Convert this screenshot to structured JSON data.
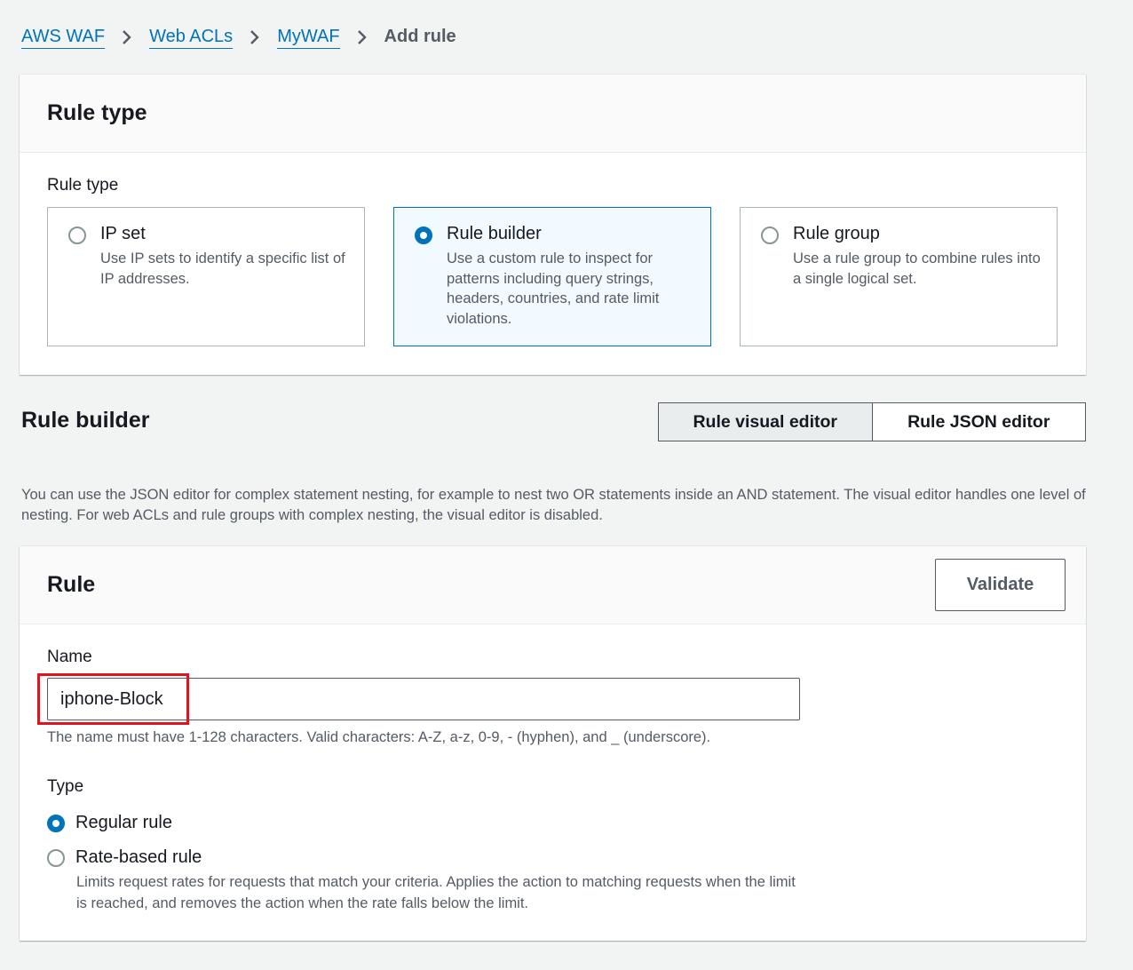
{
  "breadcrumb": {
    "items": [
      "AWS WAF",
      "Web ACLs",
      "MyWAF"
    ],
    "current": "Add rule"
  },
  "rule_type_panel": {
    "title": "Rule type",
    "field_label": "Rule type",
    "options": [
      {
        "title": "IP set",
        "description": "Use IP sets to identify a specific list of IP addresses.",
        "selected": false
      },
      {
        "title": "Rule builder",
        "description": "Use a custom rule to inspect for patterns including query strings, headers, countries, and rate limit violations.",
        "selected": true
      },
      {
        "title": "Rule group",
        "description": "Use a rule group to combine rules into a single logical set.",
        "selected": false
      }
    ]
  },
  "rule_builder": {
    "title": "Rule builder",
    "editor_tabs": [
      "Rule visual editor",
      "Rule JSON editor"
    ],
    "active_tab": "Rule visual editor",
    "help_text": "You can use the JSON editor for complex statement nesting, for example to nest two OR statements inside an AND statement. The visual editor handles one level of nesting. For web ACLs and rule groups with complex nesting, the visual editor is disabled."
  },
  "rule_panel": {
    "title": "Rule",
    "validate_label": "Validate",
    "name_label": "Name",
    "name_value": "iphone-Block",
    "name_constraint": "The name must have 1-128 characters. Valid characters: A-Z, a-z, 0-9, - (hyphen), and _ (underscore).",
    "type_label": "Type",
    "type_options": [
      {
        "label": "Regular rule",
        "selected": true
      },
      {
        "label": "Rate-based rule",
        "selected": false,
        "description": "Limits request rates for requests that match your criteria. Applies the action to matching requests when the limit is reached, and removes the action when the rate falls below the limit."
      }
    ]
  },
  "colors": {
    "link": "#0073bb",
    "selected_tile_bg": "#f1faff",
    "highlight": "#e0141e",
    "page_bg": "#f2f3f3"
  }
}
